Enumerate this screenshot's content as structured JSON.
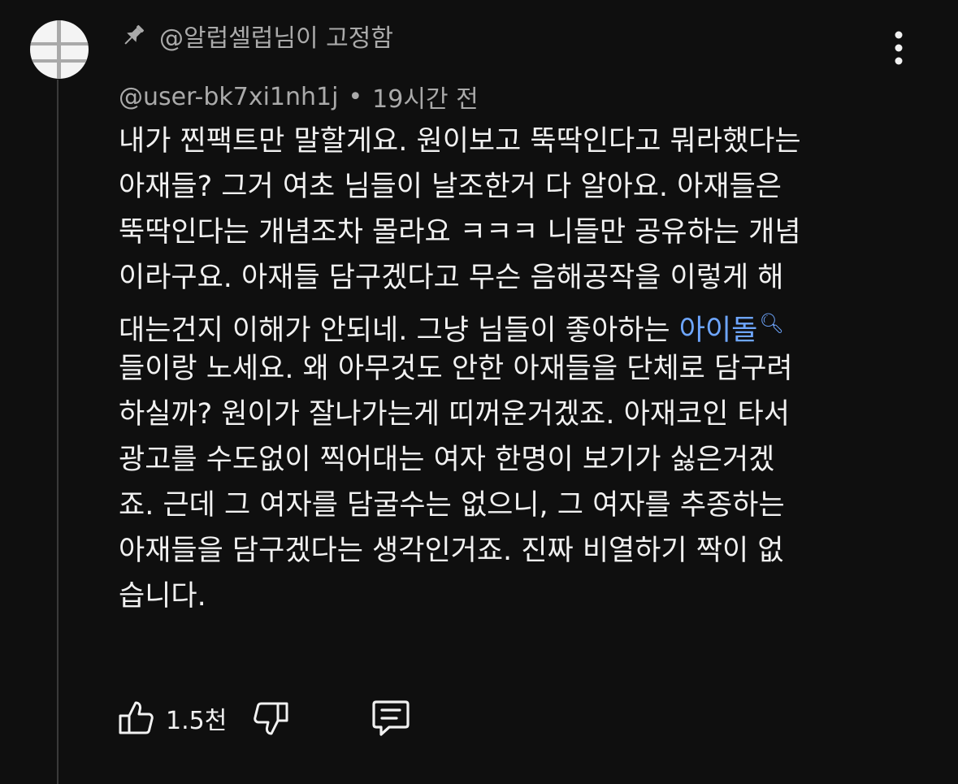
{
  "pinned": {
    "icon": "pin-icon",
    "text": "@알럽셀럽님이 고정함"
  },
  "comment": {
    "author": "@user-bk7xi1nh1j",
    "separator": "•",
    "time": "19시간 전",
    "lines": [
      "내가 찐팩트만 말할게요. 원이보고 뚝딱인다고 뭐라했다는",
      "아재들? 그거 여초 님들이 날조한거 다 알아요. 아재들은",
      "뚝딱인다는 개념조차 몰라요 ㅋㅋㅋ 니들만 공유하는 개념",
      "이라구요. 아재들 담구겠다고 무슨 음해공작을 이렇게 해",
      "대는건지 이해가 안되네. 그냥 님들이 좋아하는 ",
      "들이랑 노세요. 왜 아무것도 안한 아재들을 단체로 담구려",
      "하실까? 원이가 잘나가는게 띠꺼운거겠죠. 아재코인 타서",
      "광고를 수도없이 찍어대는 여자 한명이 보기가 싫은거겠",
      "죠. 근데 그 여자를 담굴수는 없으니, 그 여자를 추종하는",
      "아재들을 담구겠다는 생각인거죠. 진짜 비열하기 짝이 없",
      "습니다."
    ],
    "search_link": {
      "text": "아이돌",
      "icon": "search-icon"
    }
  },
  "actions": {
    "like_icon": "thumbs-up-icon",
    "like_count": "1.5천",
    "dislike_icon": "thumbs-down-icon",
    "reply_icon": "reply-comment-icon"
  },
  "menu": {
    "icon": "more-vertical-icon"
  },
  "colors": {
    "background": "#0f0f0f",
    "text": "#f1f1f1",
    "muted": "#aaaaaa",
    "link": "#6ea6ff"
  }
}
